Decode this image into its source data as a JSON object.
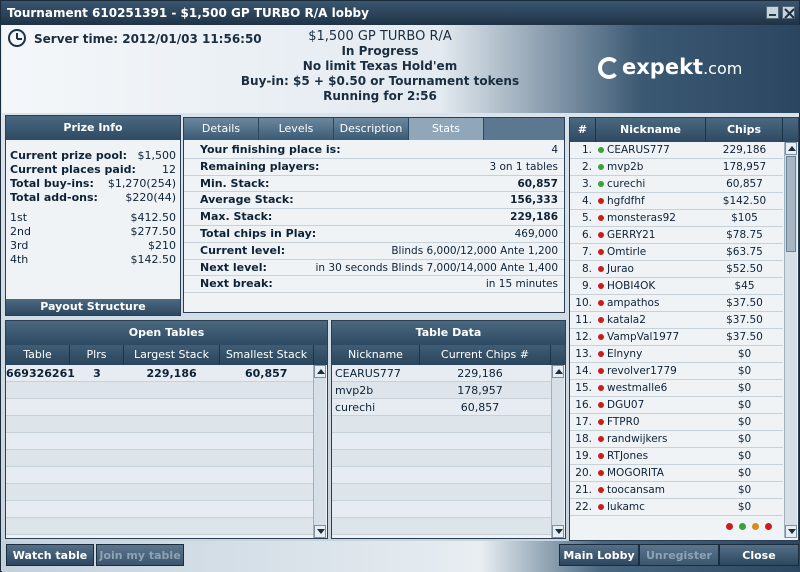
{
  "window": {
    "title": "Tournament 610251391 - $1,500 GP TURBO R/A lobby"
  },
  "header": {
    "server_time": "Server time: 2012/01/03 11:56:50",
    "name": "$1,500 GP TURBO R/A",
    "status": "In Progress",
    "game": "No limit Texas Hold'em",
    "buyin": "Buy-in: $5 + $0.50 or Tournament tokens",
    "running": "Running for 2:56",
    "logo": "expekt",
    "logo_suffix": ".com"
  },
  "prize": {
    "title": "Prize Info",
    "rows": [
      {
        "k": "Current prize pool:",
        "v": "$1,500"
      },
      {
        "k": "Current places paid:",
        "v": "12"
      },
      {
        "k": "Total buy-ins:",
        "v": "$1,270(254)"
      },
      {
        "k": "Total add-ons:",
        "v": "$220(44)"
      }
    ],
    "places": [
      {
        "k": "1st",
        "v": "$412.50"
      },
      {
        "k": "2nd",
        "v": "$277.50"
      },
      {
        "k": "3rd",
        "v": "$210"
      },
      {
        "k": "4th",
        "v": "$142.50"
      }
    ],
    "payout_button": "Payout Structure"
  },
  "details": {
    "tabs": [
      "Details",
      "Levels",
      "Description",
      "Stats"
    ],
    "stats": [
      {
        "k": "Your finishing place is:",
        "v": "4",
        "bold": false
      },
      {
        "k": "Remaining players:",
        "v": "3 on 1 tables",
        "bold": false
      },
      {
        "k": "Min. Stack:",
        "v": "60,857",
        "bold": true
      },
      {
        "k": "Average Stack:",
        "v": "156,333",
        "bold": true
      },
      {
        "k": "Max. Stack:",
        "v": "229,186",
        "bold": true
      },
      {
        "k": "Total chips in Play:",
        "v": "469,000",
        "bold": false
      },
      {
        "k": "Current level:",
        "v": "Blinds 6,000/12,000 Ante 1,200",
        "bold": false
      },
      {
        "k": "Next level:",
        "v": "in 30 seconds Blinds 7,000/14,000 Ante 1,400",
        "bold": false
      },
      {
        "k": "Next break:",
        "v": "in 15 minutes",
        "bold": false
      }
    ]
  },
  "players": {
    "columns": [
      "#",
      "Nickname",
      "Chips"
    ],
    "rows": [
      {
        "n": "1.",
        "nick": "CEARUS777",
        "chips": "229,186",
        "status": "green"
      },
      {
        "n": "2.",
        "nick": "mvp2b",
        "chips": "178,957",
        "status": "green"
      },
      {
        "n": "3.",
        "nick": "curechi",
        "chips": "60,857",
        "status": "green"
      },
      {
        "n": "4.",
        "nick": "hgfdfhf",
        "chips": "$142.50",
        "status": "red"
      },
      {
        "n": "5.",
        "nick": "monsteras92",
        "chips": "$105",
        "status": "red"
      },
      {
        "n": "6.",
        "nick": "GERRY21",
        "chips": "$78.75",
        "status": "red"
      },
      {
        "n": "7.",
        "nick": "Omtirle",
        "chips": "$63.75",
        "status": "red"
      },
      {
        "n": "8.",
        "nick": "Jurao",
        "chips": "$52.50",
        "status": "red"
      },
      {
        "n": "9.",
        "nick": "HOBI4OK",
        "chips": "$45",
        "status": "red"
      },
      {
        "n": "10.",
        "nick": "ampathos",
        "chips": "$37.50",
        "status": "red"
      },
      {
        "n": "11.",
        "nick": "katala2",
        "chips": "$37.50",
        "status": "red"
      },
      {
        "n": "12.",
        "nick": "VampVal1977",
        "chips": "$37.50",
        "status": "red"
      },
      {
        "n": "13.",
        "nick": "Elnyny",
        "chips": "$0",
        "status": "red"
      },
      {
        "n": "14.",
        "nick": "revolver1779",
        "chips": "$0",
        "status": "red"
      },
      {
        "n": "15.",
        "nick": "westmalle6",
        "chips": "$0",
        "status": "red"
      },
      {
        "n": "16.",
        "nick": "DGU07",
        "chips": "$0",
        "status": "red"
      },
      {
        "n": "17.",
        "nick": "FTPR0",
        "chips": "$0",
        "status": "red"
      },
      {
        "n": "18.",
        "nick": "randwijkers",
        "chips": "$0",
        "status": "red"
      },
      {
        "n": "19.",
        "nick": "RTJones",
        "chips": "$0",
        "status": "red"
      },
      {
        "n": "20.",
        "nick": "MOGORITA",
        "chips": "$0",
        "status": "red"
      },
      {
        "n": "21.",
        "nick": "toocansam",
        "chips": "$0",
        "status": "red"
      },
      {
        "n": "22.",
        "nick": "lukamc",
        "chips": "$0",
        "status": "red"
      }
    ],
    "legend_colors": [
      "#c81e1e",
      "#3aa13a",
      "#d88a1a",
      "#c81e1e"
    ]
  },
  "open_tables": {
    "title": "Open Tables",
    "columns": [
      "Table",
      "Plrs",
      "Largest Stack",
      "Smallest Stack"
    ],
    "rows": [
      {
        "table": "669326261",
        "plrs": "3",
        "largest": "229,186",
        "smallest": "60,857"
      }
    ]
  },
  "table_data": {
    "title": "Table Data",
    "columns": [
      "Nickname",
      "Current Chips #"
    ],
    "rows": [
      {
        "nick": "CEARUS777",
        "chips": "229,186"
      },
      {
        "nick": "mvp2b",
        "chips": "178,957"
      },
      {
        "nick": "curechi",
        "chips": "60,857"
      }
    ]
  },
  "buttons": {
    "watch": "Watch table",
    "join": "Join my table",
    "main_lobby": "Main Lobby",
    "unregister": "Unregister",
    "close": "Close"
  }
}
